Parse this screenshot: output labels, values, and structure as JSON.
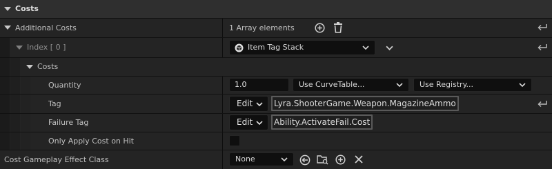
{
  "header": {
    "title": "Costs"
  },
  "additional_costs": {
    "label": "Additional Costs",
    "count_text": "1 Array elements",
    "add_icon": "add-circle-icon",
    "delete_icon": "trash-icon",
    "reset_icon": "reset-to-default-icon"
  },
  "index_row": {
    "label": "Index",
    "index_text": "[ 0 ]",
    "type_value": "Item Tag Stack",
    "type_icon": "struct-icon"
  },
  "costs_group": {
    "label": "Costs"
  },
  "quantity": {
    "label": "Quantity",
    "value": "1.0",
    "curve_table": "Use CurveTable...",
    "registry": "Use Registry..."
  },
  "tag": {
    "label": "Tag",
    "edit_label": "Edit",
    "value": "Lyra.ShooterGame.Weapon.MagazineAmmo"
  },
  "failure_tag": {
    "label": "Failure Tag",
    "edit_label": "Edit",
    "value": "Ability.ActivateFail.Cost"
  },
  "only_apply": {
    "label": "Only Apply Cost on Hit",
    "checked": false
  },
  "cost_ge_class": {
    "label": "Cost Gameplay Effect Class",
    "value": "None",
    "icons": [
      "use-selected-arrow-icon",
      "browse-folder-icon",
      "add-circle-icon",
      "clear-x-icon"
    ]
  },
  "colors": {
    "background": "#1a1a1a",
    "header_bg": "#2f2f2f",
    "row_bg": "#242424",
    "field_bg": "#0f0f0f",
    "text": "#c0c0c0"
  }
}
